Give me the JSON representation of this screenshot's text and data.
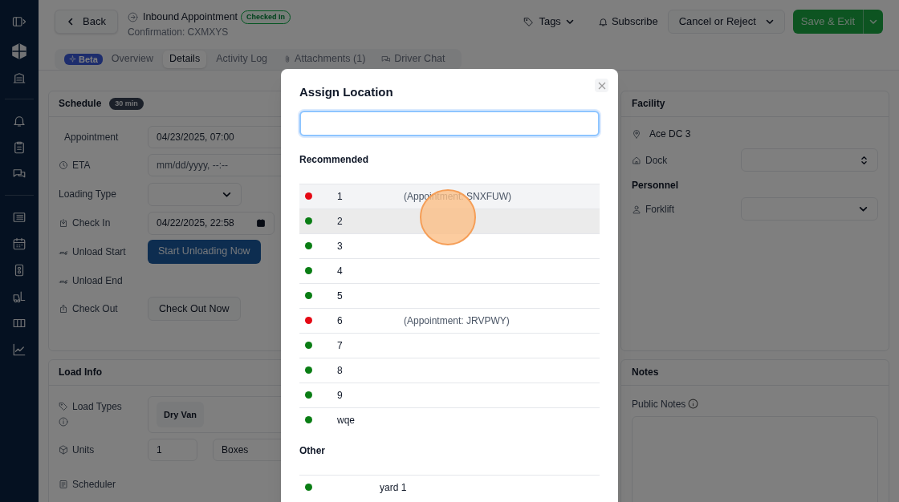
{
  "header": {
    "back": "Back",
    "title": "Inbound Appointment",
    "status": "Checked In",
    "confirmation": "Confirmation: CXMXYS",
    "actions": [
      {
        "label": "Tags",
        "kind": "menu"
      },
      {
        "label": "Subscribe",
        "kind": "plain"
      },
      {
        "label": "Cancel or Reject",
        "kind": "outline"
      },
      {
        "label": "Save & Exit",
        "kind": "primary"
      }
    ]
  },
  "tabs": [
    {
      "label": "Overview",
      "badge": "Beta",
      "selected": false
    },
    {
      "label": "Details",
      "selected": true
    },
    {
      "label": "Activity Log",
      "selected": false
    },
    {
      "label": "Attachments (1)",
      "selected": false
    },
    {
      "label": "Driver Chat",
      "selected": false
    }
  ],
  "schedule": {
    "title": "Schedule",
    "badge": "30 min",
    "rows": [
      {
        "label": "Appointment",
        "kind": "text",
        "value": "04/23/2025, 07:00"
      },
      {
        "label": "ETA",
        "kind": "text",
        "placeholder": "mm/dd/yyyy, --:--"
      },
      {
        "label": "Loading Type",
        "kind": "select"
      },
      {
        "label": "Check In",
        "kind": "datetime",
        "value": "04/22/2025, 22:58"
      },
      {
        "label": "Unload Start",
        "kind": "button",
        "button": "Start Unloading Now",
        "primary": true
      },
      {
        "label": "Unload End",
        "kind": "empty"
      },
      {
        "label": "Check Out",
        "kind": "button",
        "button": "Check Out Now",
        "primary": false
      }
    ]
  },
  "load_info": {
    "title": "Load Info",
    "load_types_label": "Load Types",
    "load_types": [
      "Dry Van"
    ],
    "units_label": "Units",
    "units": "1",
    "unit_kind": "Boxes",
    "scheduler_label": "Scheduler"
  },
  "facility": {
    "title": "Facility",
    "name": "Ace DC 3",
    "dock_label": "Dock",
    "personnel_title": "Personnel",
    "forklift_label": "Forklift"
  },
  "notes": {
    "title": "Notes",
    "public_notes_label": "Public Notes"
  },
  "modal": {
    "title": "Assign Location",
    "groups": [
      {
        "title": "Recommended",
        "kind": "with-notes",
        "rows": [
          {
            "name": "1",
            "note": "(Appointment: SNXFUW)",
            "color": "#e50914",
            "active": true,
            "hovered": false
          },
          {
            "name": "2",
            "color": "#0a7d14",
            "active": false,
            "hovered": true
          },
          {
            "name": "3",
            "color": "#0a7d14",
            "active": false,
            "hovered": false
          },
          {
            "name": "4",
            "color": "#0a7d14",
            "active": false,
            "hovered": false
          },
          {
            "name": "5",
            "color": "#0a7d14",
            "active": false,
            "hovered": false
          },
          {
            "name": "6",
            "note": "(Appointment: JRVPWY)",
            "color": "#e50914",
            "active": false,
            "hovered": false
          },
          {
            "name": "7",
            "color": "#0a7d14",
            "active": false,
            "hovered": false
          },
          {
            "name": "8",
            "color": "#0a7d14",
            "active": false,
            "hovered": false
          },
          {
            "name": "9",
            "color": "#0a7d14",
            "active": false,
            "hovered": false
          },
          {
            "name": "wqe",
            "color": "#0a7d14",
            "active": false,
            "hovered": false
          }
        ]
      },
      {
        "title": "Other",
        "kind": "plain",
        "rows": [
          {
            "name": "yard 1",
            "color": "#0a7d14",
            "active": false,
            "hovered": false
          }
        ]
      }
    ]
  }
}
